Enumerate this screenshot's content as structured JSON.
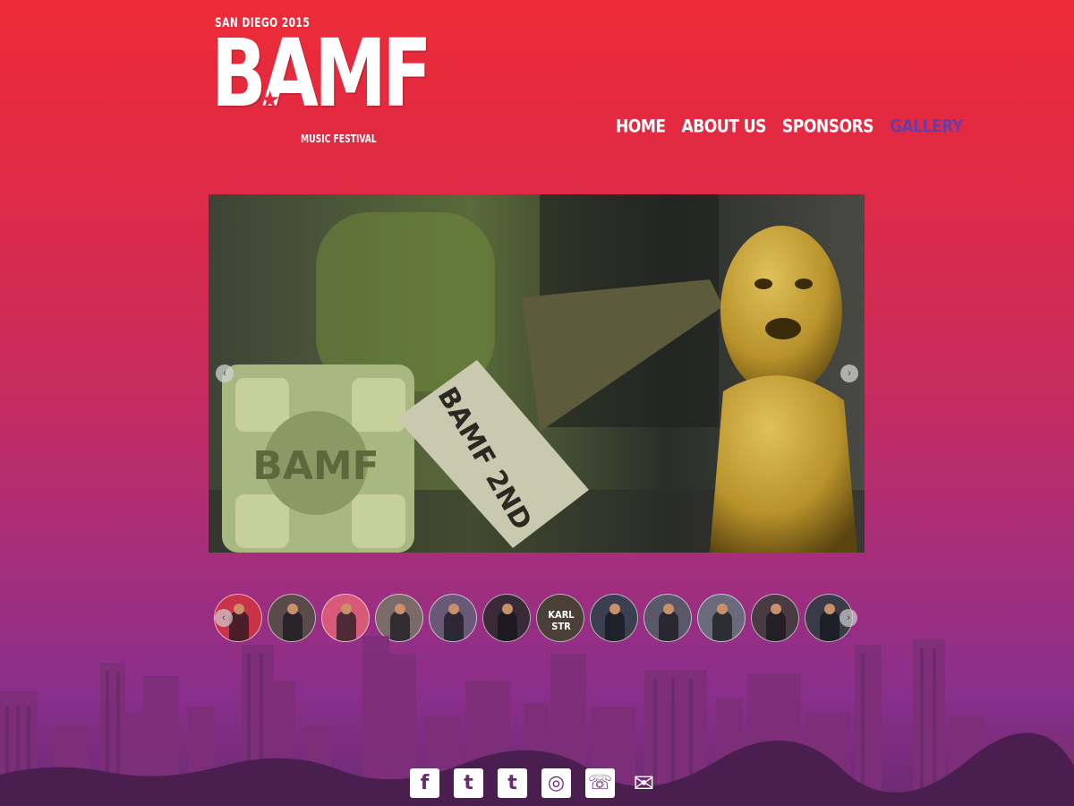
{
  "logo": {
    "top_text": "SAN DIEGO 2015",
    "main_text": "BAMF",
    "bottom_text": "MUSIC FESTIVAL"
  },
  "nav": {
    "items": [
      {
        "label": "HOME",
        "active": false
      },
      {
        "label": "ABOUT US",
        "active": false
      },
      {
        "label": "SPONSORS",
        "active": false
      },
      {
        "label": "GALLERY",
        "active": true
      }
    ],
    "active_color": "#6b3ca8"
  },
  "slider": {
    "prev_glyph": "‹",
    "next_glyph": "›",
    "cube_text": "BAMF",
    "hammer_text": "BAMF 2ND"
  },
  "thumbnails": {
    "count": 12,
    "items": [
      {
        "bg": "#c8324a"
      },
      {
        "bg": "#5a4a4a"
      },
      {
        "bg": "#d85a78"
      },
      {
        "bg": "#7a6a6a"
      },
      {
        "bg": "#6a5878"
      },
      {
        "bg": "#3a2a38"
      },
      {
        "bg": "#4a4038",
        "text": "KARL STR"
      },
      {
        "bg": "#3a4050"
      },
      {
        "bg": "#5a5868"
      },
      {
        "bg": "#6a6a7a"
      },
      {
        "bg": "#4a3a44"
      },
      {
        "bg": "#3a3a48"
      }
    ],
    "prev_glyph": "‹",
    "next_glyph": "›"
  },
  "social": {
    "icons": [
      {
        "name": "facebook-icon",
        "glyph": "f"
      },
      {
        "name": "twitter-icon",
        "glyph": "t"
      },
      {
        "name": "tumblr-icon",
        "glyph": "t"
      },
      {
        "name": "instagram-icon",
        "glyph": "◎"
      },
      {
        "name": "phone-icon",
        "glyph": "☏"
      },
      {
        "name": "email-icon",
        "glyph": "✉"
      }
    ]
  }
}
